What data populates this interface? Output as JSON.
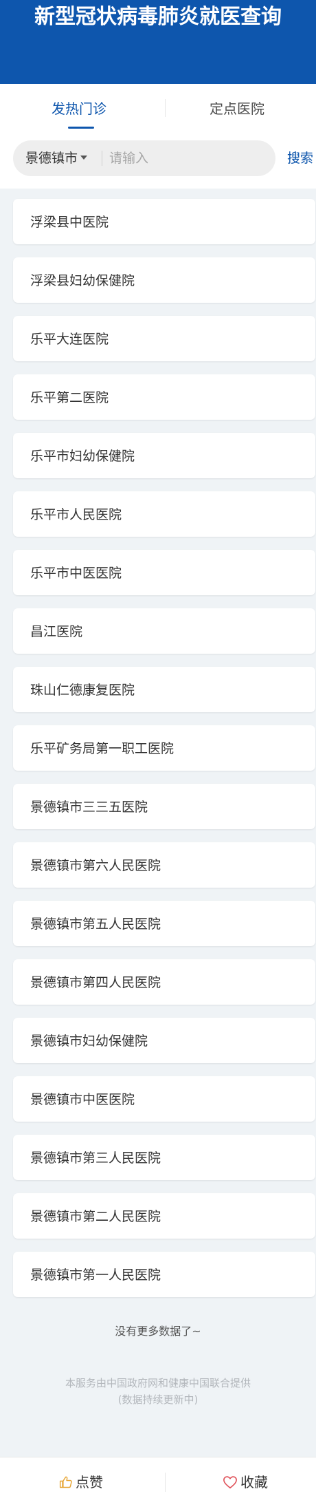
{
  "header": {
    "title": "新型冠状病毒肺炎就医查询"
  },
  "tabs": [
    {
      "label": "发热门诊",
      "active": true
    },
    {
      "label": "定点医院",
      "active": false
    }
  ],
  "search": {
    "city": "景德镇市",
    "placeholder": "请输入",
    "value": "",
    "button_label": "搜索"
  },
  "hospitals": [
    "浮梁县中医院",
    "浮梁县妇幼保健院",
    "乐平大连医院",
    "乐平第二医院",
    "乐平市妇幼保健院",
    "乐平市人民医院",
    "乐平市中医医院",
    "昌江医院",
    "珠山仁德康复医院",
    "乐平矿务局第一职工医院",
    "景德镇市三三五医院",
    "景德镇市第六人民医院",
    "景德镇市第五人民医院",
    "景德镇市第四人民医院",
    "景德镇市妇幼保健院",
    "景德镇市中医医院",
    "景德镇市第三人民医院",
    "景德镇市第二人民医院",
    "景德镇市第一人民医院"
  ],
  "list_end": "没有更多数据了~",
  "footer": {
    "line1": "本服务由中国政府网和健康中国联合提供",
    "line2": "(数据持续更新中)"
  },
  "bottom_bar": {
    "like_label": "点赞",
    "like_icon": "thumbs-up-icon",
    "favorite_label": "收藏",
    "favorite_icon": "heart-icon"
  },
  "colors": {
    "brand_blue": "#0e56ad",
    "background": "#eff3f6",
    "like_icon": "#e8a83a",
    "favorite_icon": "#e0525a"
  }
}
